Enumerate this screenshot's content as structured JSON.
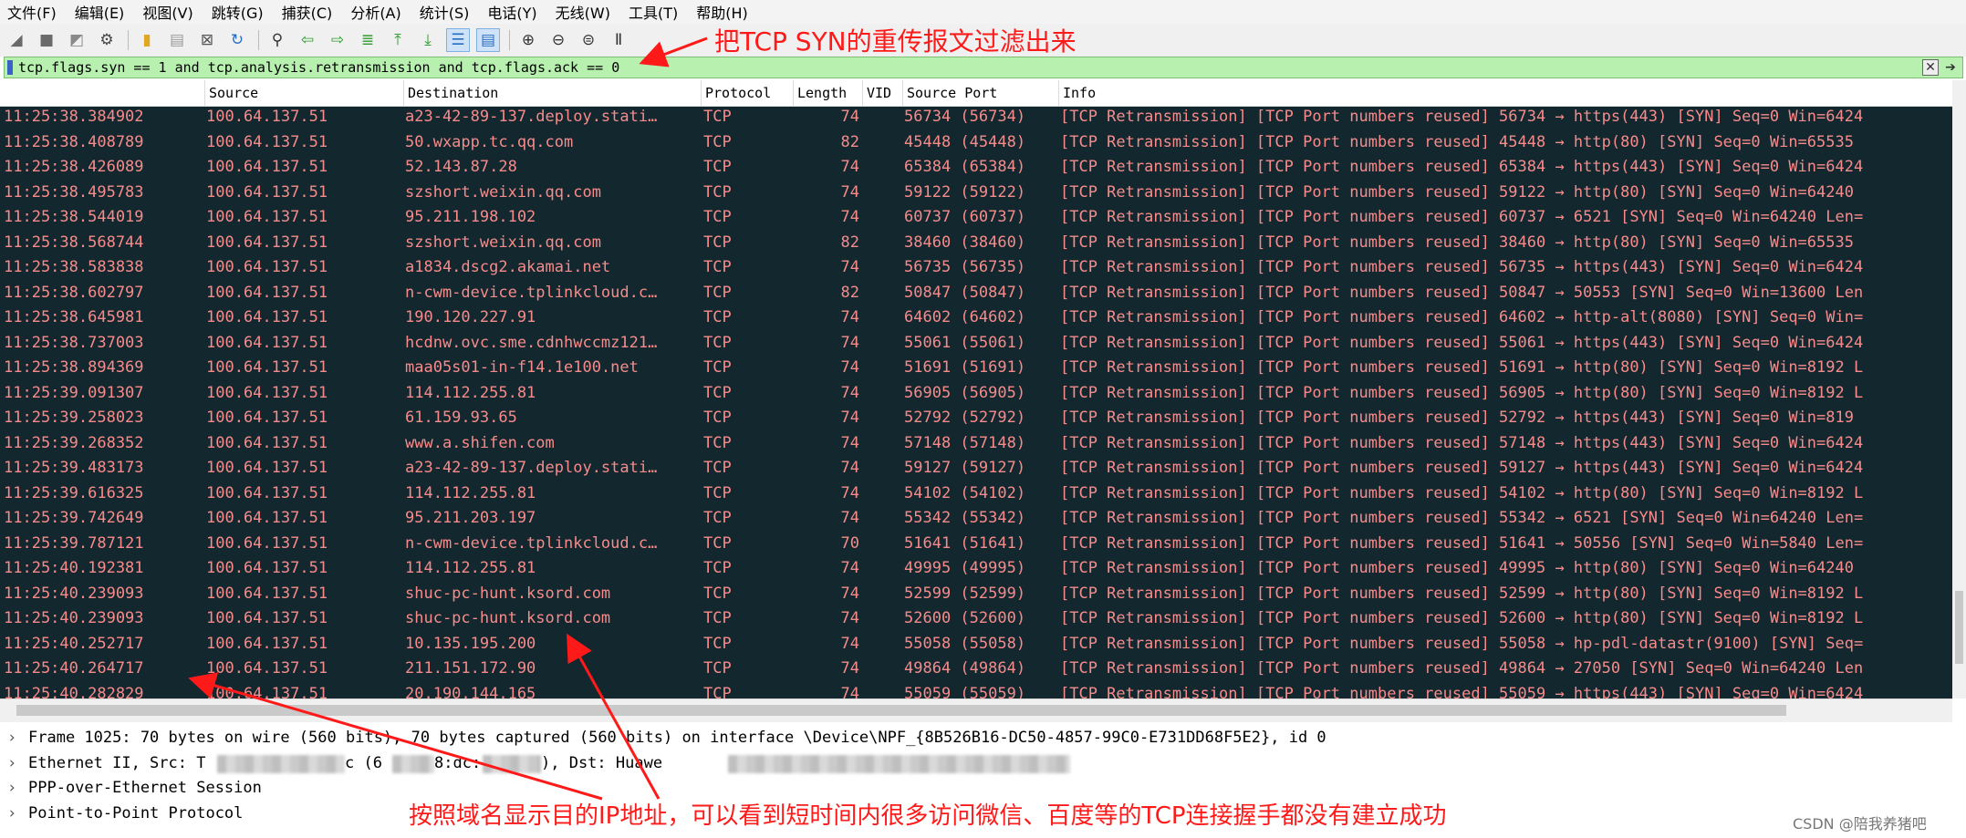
{
  "menu": [
    "文件(F)",
    "编辑(E)",
    "视图(V)",
    "跳转(G)",
    "捕获(C)",
    "分析(A)",
    "统计(S)",
    "电话(Y)",
    "无线(W)",
    "工具(T)",
    "帮助(H)"
  ],
  "toolbar": {
    "icons": [
      "shark-start-icon",
      "stop-icon",
      "restart-icon",
      "options-gear-icon",
      "open-file-icon",
      "save-file-icon",
      "close-file-icon",
      "reload-icon",
      "find-icon",
      "go-back-icon",
      "go-forward-icon",
      "go-to-packet-icon",
      "first-packet-icon",
      "last-packet-icon",
      "autoscroll-icon",
      "colorize-icon",
      "zoom-in-icon",
      "zoom-out-icon",
      "zoom-normal-icon",
      "resize-columns-icon"
    ]
  },
  "filter": {
    "value": "tcp.flags.syn == 1 and tcp.analysis.retransmission and tcp.flags.ack == 0"
  },
  "columns": [
    "Source",
    "Destination",
    "Protocol",
    "Length",
    "VID",
    "Source Port",
    "Info"
  ],
  "packets": [
    {
      "time": "11:25:38.384902",
      "src": "100.64.137.51",
      "dst": "a23-42-89-137.deploy.stati…",
      "proto": "TCP",
      "len": "74",
      "sport": "56734 (56734)",
      "info": "[TCP Retransmission] [TCP Port numbers reused] 56734 → https(443) [SYN] Seq=0 Win=6424"
    },
    {
      "time": "11:25:38.408789",
      "src": "100.64.137.51",
      "dst": "50.wxapp.tc.qq.com",
      "proto": "TCP",
      "len": "82",
      "sport": "45448 (45448)",
      "info": "[TCP Retransmission] [TCP Port numbers reused] 45448 → http(80) [SYN] Seq=0 Win=65535"
    },
    {
      "time": "11:25:38.426089",
      "src": "100.64.137.51",
      "dst": "52.143.87.28",
      "proto": "TCP",
      "len": "74",
      "sport": "65384 (65384)",
      "info": "[TCP Retransmission] [TCP Port numbers reused] 65384 → https(443) [SYN] Seq=0 Win=6424"
    },
    {
      "time": "11:25:38.495783",
      "src": "100.64.137.51",
      "dst": "szshort.weixin.qq.com",
      "proto": "TCP",
      "len": "74",
      "sport": "59122 (59122)",
      "info": "[TCP Retransmission] [TCP Port numbers reused] 59122 → http(80) [SYN] Seq=0 Win=64240"
    },
    {
      "time": "11:25:38.544019",
      "src": "100.64.137.51",
      "dst": "95.211.198.102",
      "proto": "TCP",
      "len": "74",
      "sport": "60737 (60737)",
      "info": "[TCP Retransmission] [TCP Port numbers reused] 60737 → 6521 [SYN] Seq=0 Win=64240 Len="
    },
    {
      "time": "11:25:38.568744",
      "src": "100.64.137.51",
      "dst": "szshort.weixin.qq.com",
      "proto": "TCP",
      "len": "82",
      "sport": "38460 (38460)",
      "info": "[TCP Retransmission] [TCP Port numbers reused] 38460 → http(80) [SYN] Seq=0 Win=65535"
    },
    {
      "time": "11:25:38.583838",
      "src": "100.64.137.51",
      "dst": "a1834.dscg2.akamai.net",
      "proto": "TCP",
      "len": "74",
      "sport": "56735 (56735)",
      "info": "[TCP Retransmission] [TCP Port numbers reused] 56735 → https(443) [SYN] Seq=0 Win=6424"
    },
    {
      "time": "11:25:38.602797",
      "src": "100.64.137.51",
      "dst": "n-cwm-device.tplinkcloud.c…",
      "proto": "TCP",
      "len": "82",
      "sport": "50847 (50847)",
      "info": "[TCP Retransmission] [TCP Port numbers reused] 50847 → 50553 [SYN] Seq=0 Win=13600 Len"
    },
    {
      "time": "11:25:38.645981",
      "src": "100.64.137.51",
      "dst": "190.120.227.91",
      "proto": "TCP",
      "len": "74",
      "sport": "64602 (64602)",
      "info": "[TCP Retransmission] [TCP Port numbers reused] 64602 → http-alt(8080) [SYN] Seq=0 Win="
    },
    {
      "time": "11:25:38.737003",
      "src": "100.64.137.51",
      "dst": "hcdnw.ovc.sme.cdnhwccmz121…",
      "proto": "TCP",
      "len": "74",
      "sport": "55061 (55061)",
      "info": "[TCP Retransmission] [TCP Port numbers reused] 55061 → https(443) [SYN] Seq=0 Win=6424"
    },
    {
      "time": "11:25:38.894369",
      "src": "100.64.137.51",
      "dst": "maa05s01-in-f14.1e100.net",
      "proto": "TCP",
      "len": "74",
      "sport": "51691 (51691)",
      "info": "[TCP Retransmission] [TCP Port numbers reused] 51691 → http(80) [SYN] Seq=0 Win=8192 L"
    },
    {
      "time": "11:25:39.091307",
      "src": "100.64.137.51",
      "dst": "114.112.255.81",
      "proto": "TCP",
      "len": "74",
      "sport": "56905 (56905)",
      "info": "[TCP Retransmission] [TCP Port numbers reused] 56905 → http(80) [SYN] Seq=0 Win=8192 L"
    },
    {
      "time": "11:25:39.258023",
      "src": "100.64.137.51",
      "dst": "61.159.93.65",
      "proto": "TCP",
      "len": "74",
      "sport": "52792 (52792)",
      "info": "[TCP Retransmission] [TCP Port numbers reused] 52792 → https(443) [SYN] Seq=0 Win=819"
    },
    {
      "time": "11:25:39.268352",
      "src": "100.64.137.51",
      "dst": "www.a.shifen.com",
      "proto": "TCP",
      "len": "74",
      "sport": "57148 (57148)",
      "info": "[TCP Retransmission] [TCP Port numbers reused] 57148 → https(443) [SYN] Seq=0 Win=6424"
    },
    {
      "time": "11:25:39.483173",
      "src": "100.64.137.51",
      "dst": "a23-42-89-137.deploy.stati…",
      "proto": "TCP",
      "len": "74",
      "sport": "59127 (59127)",
      "info": "[TCP Retransmission] [TCP Port numbers reused] 59127 → https(443) [SYN] Seq=0 Win=6424"
    },
    {
      "time": "11:25:39.616325",
      "src": "100.64.137.51",
      "dst": "114.112.255.81",
      "proto": "TCP",
      "len": "74",
      "sport": "54102 (54102)",
      "info": "[TCP Retransmission] [TCP Port numbers reused] 54102 → http(80) [SYN] Seq=0 Win=8192 L"
    },
    {
      "time": "11:25:39.742649",
      "src": "100.64.137.51",
      "dst": "95.211.203.197",
      "proto": "TCP",
      "len": "74",
      "sport": "55342 (55342)",
      "info": "[TCP Retransmission] [TCP Port numbers reused] 55342 → 6521 [SYN] Seq=0 Win=64240 Len="
    },
    {
      "time": "11:25:39.787121",
      "src": "100.64.137.51",
      "dst": "n-cwm-device.tplinkcloud.c…",
      "proto": "TCP",
      "len": "70",
      "sport": "51641 (51641)",
      "info": "[TCP Retransmission] [TCP Port numbers reused] 51641 → 50556 [SYN] Seq=0 Win=5840 Len="
    },
    {
      "time": "11:25:40.192381",
      "src": "100.64.137.51",
      "dst": "114.112.255.81",
      "proto": "TCP",
      "len": "74",
      "sport": "49995 (49995)",
      "info": "[TCP Retransmission] [TCP Port numbers reused] 49995 → http(80) [SYN] Seq=0 Win=64240"
    },
    {
      "time": "11:25:40.239093",
      "src": "100.64.137.51",
      "dst": "shuc-pc-hunt.ksord.com",
      "proto": "TCP",
      "len": "74",
      "sport": "52599 (52599)",
      "info": "[TCP Retransmission] [TCP Port numbers reused] 52599 → http(80) [SYN] Seq=0 Win=8192 L"
    },
    {
      "time": "11:25:40.239093",
      "src": "100.64.137.51",
      "dst": "shuc-pc-hunt.ksord.com",
      "proto": "TCP",
      "len": "74",
      "sport": "52600 (52600)",
      "info": "[TCP Retransmission] [TCP Port numbers reused] 52600 → http(80) [SYN] Seq=0 Win=8192 L"
    },
    {
      "time": "11:25:40.252717",
      "src": "100.64.137.51",
      "dst": "10.135.195.200",
      "proto": "TCP",
      "len": "74",
      "sport": "55058 (55058)",
      "info": "[TCP Retransmission] [TCP Port numbers reused] 55058 → hp-pdl-datastr(9100) [SYN] Seq="
    },
    {
      "time": "11:25:40.264717",
      "src": "100.64.137.51",
      "dst": "211.151.172.90",
      "proto": "TCP",
      "len": "74",
      "sport": "49864 (49864)",
      "info": "[TCP Retransmission] [TCP Port numbers reused] 49864 → 27050 [SYN] Seq=0 Win=64240 Len"
    },
    {
      "time": "11:25:40.282829",
      "src": "100.64.137.51",
      "dst": "20.190.144.165",
      "proto": "TCP",
      "len": "74",
      "sport": "55059 (55059)",
      "info": "[TCP Retransmission] [TCP Port numbers reused] 55059 → https(443) [SYN] Seq=0 Win=6424"
    }
  ],
  "details": [
    "Frame 1025: 70 bytes on wire (560 bits), 70 bytes captured (560 bits) on interface \\Device\\NPF_{8B526B16-DC50-4857-99C0-E731DD68F5E2}, id 0",
    "Ethernet II, Src: T",
    "PPP-over-Ethernet Session",
    "Point-to-Point Protocol"
  ],
  "details_partial": {
    "src_mid": "c (6",
    "src_mid2": "8:dc:",
    "src_end": "), Dst: Huawe"
  },
  "annotations": {
    "top": "把TCP SYN的重传报文过滤出来",
    "bottom": "按照域名显示目的IP地址，可以看到短时间内很多访问微信、百度等的TCP连接握手都没有建立成功"
  },
  "watermark": "CSDN @陪我养猪吧",
  "colors": {
    "packet_bg": "#12272e",
    "packet_text": "#f78b8b",
    "filter_bg": "#b8f0b0",
    "annotation": "#ff1a1a"
  }
}
